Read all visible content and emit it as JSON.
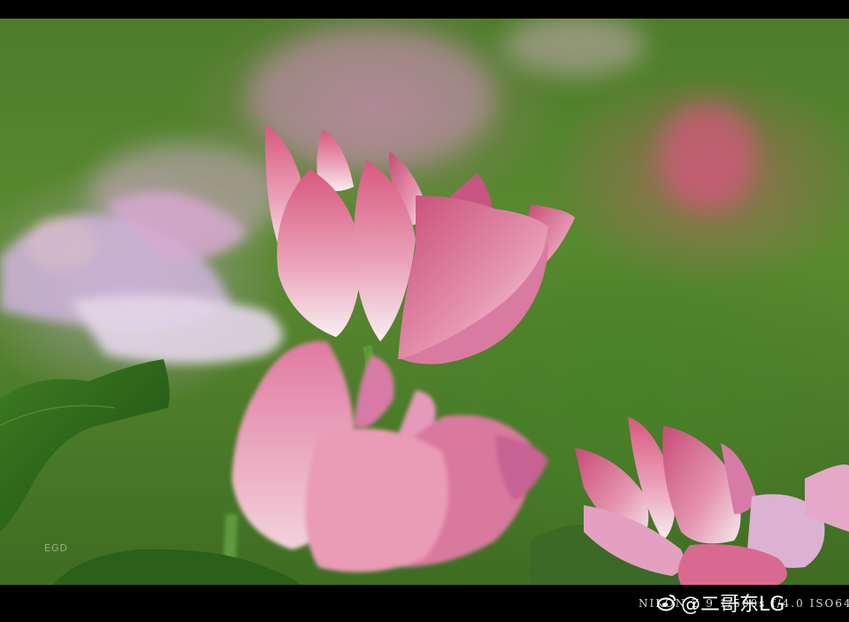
{
  "watermark": {
    "camera_info": "NIKON Z 9  1/500s f/4.0  ISO64",
    "handle": "@二哥东LG",
    "corner_mark": "EGD"
  },
  "colors": {
    "frame": "#000000",
    "background_green": "#4d7d2a",
    "petal_pink": "#e57a9a",
    "petal_light": "#f6e4ea",
    "leaf_green": "#2f6a1c"
  }
}
